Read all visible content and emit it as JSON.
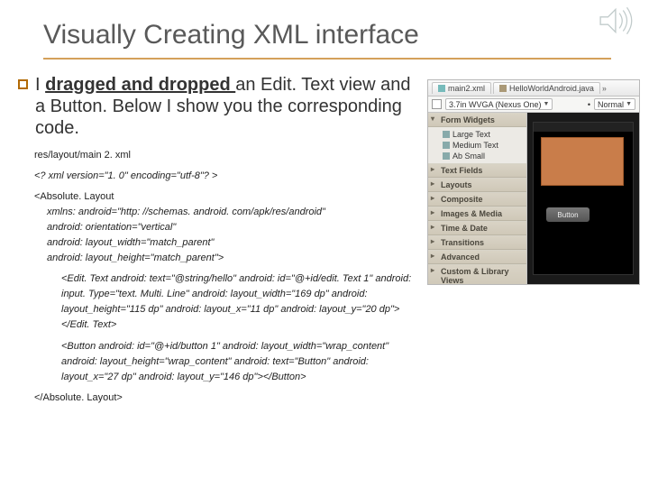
{
  "title": "Visually Creating XML interface",
  "bullet": {
    "prefix": "I ",
    "underlined": "dragged and dropped ",
    "rest": "an Edit. Text view and a Button.   Below I show you the corresponding code."
  },
  "code": {
    "path": "res/layout/main 2. xml",
    "decl": "<? xml version=\"1. 0\" encoding=\"utf-8\"? >",
    "root_open": "<Absolute. Layout",
    "root_attrs": [
      "xmlns: android=\"http: //schemas. android. com/apk/res/android\"",
      "android: orientation=\"vertical\"",
      "android: layout_width=\"match_parent\"",
      "android: layout_height=\"match_parent\">"
    ],
    "edit": "<Edit. Text android: text=\"@string/hello\" android: id=\"@+id/edit. Text 1\" android: input. Type=\"text. Multi. Line\" android: layout_width=\"169 dp\" android: layout_height=\"115 dp\" android: layout_x=\"11 dp\" android: layout_y=\"20 dp\"></Edit. Text>",
    "button": "<Button android: id=\"@+id/button 1\" android: layout_width=\"wrap_content\" android: layout_height=\"wrap_content\" android: text=\"Button\" android: layout_x=\"27 dp\" android: layout_y=\"146 dp\"></Button>",
    "root_close": "</Absolute. Layout>"
  },
  "editor": {
    "tabs": [
      "main2.xml",
      "HelloWorldAndroid.java"
    ],
    "config": "3.7in WVGA (Nexus One)",
    "mode": "Normal",
    "palette": {
      "open_header": "Form Widgets",
      "open_items": [
        "Large Text",
        "Medium Text",
        "Ab Small"
      ],
      "closed_headers": [
        "Text Fields",
        "Layouts",
        "Composite",
        "Images & Media",
        "Time & Date",
        "Transitions",
        "Advanced",
        "Custom & Library Views"
      ]
    },
    "button_label": "Button"
  }
}
